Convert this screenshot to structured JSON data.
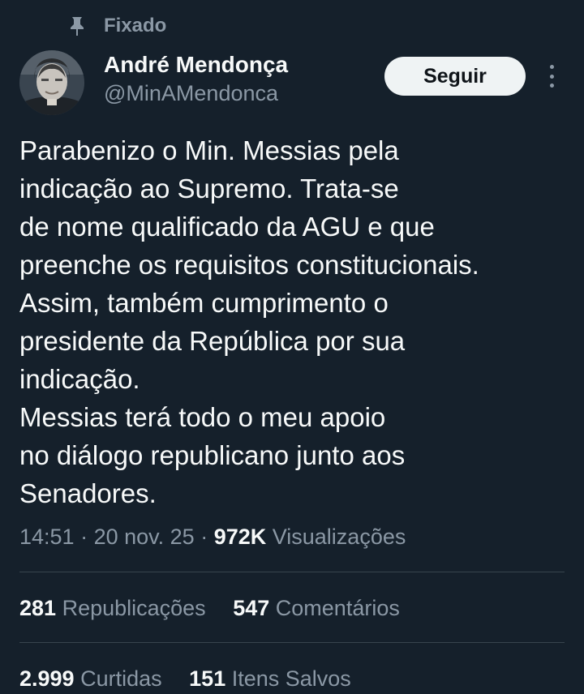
{
  "pinned": {
    "label": "Fixado",
    "icon": "pin-icon"
  },
  "author": {
    "name": "André Mendonça",
    "handle": "@MinAMendonca",
    "avatar": "avatar-photo"
  },
  "actions": {
    "follow_label": "Seguir",
    "more_icon": "more-vertical-icon"
  },
  "tweet": {
    "lines": [
      "Parabenizo o Min. Messias pela",
      "indicação ao Supremo. Trata-se",
      "de nome qualificado da AGU e que",
      "preenche os requisitos constitucionais.",
      "Assim, também cumprimento o",
      "presidente da República por sua",
      "indicação.",
      "Messias terá todo o meu apoio",
      "no diálogo republicano junto aos",
      "Senadores."
    ]
  },
  "meta": {
    "time": "14:51",
    "separator": " · ",
    "date": "20 nov. 25",
    "views_count": "972K",
    "views_label": "Visualizações"
  },
  "stats": {
    "reposts_count": "281",
    "reposts_label": "Republicações",
    "comments_count": "547",
    "comments_label": "Comentários",
    "likes_count": "2.999",
    "likes_label": "Curtidas",
    "saves_count": "151",
    "saves_label": "Itens Salvos"
  },
  "colors": {
    "background": "#15202b",
    "text_primary": "#f7f9f9",
    "text_secondary": "#8b98a5",
    "divider": "#38444d",
    "button_bg": "#eff3f4"
  }
}
